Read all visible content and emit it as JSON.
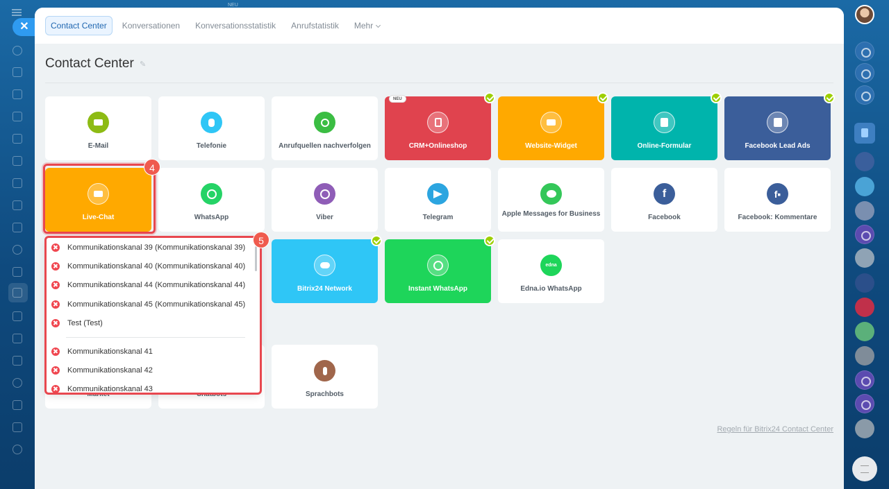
{
  "topbar": {
    "neu_label": "NEU"
  },
  "nav": {
    "tabs": [
      {
        "label": "Contact Center"
      },
      {
        "label": "Konversationen"
      },
      {
        "label": "Konversationsstatistik"
      },
      {
        "label": "Anrufstatistik"
      },
      {
        "label": "Mehr"
      }
    ]
  },
  "page": {
    "title": "Contact Center"
  },
  "cards": {
    "email": "E-Mail",
    "telefonie": "Telefonie",
    "anrufquellen": "Anrufquellen nachverfolgen",
    "crm": "CRM+Onlineshop",
    "crm_badge": "NEU",
    "website": "Website-Widget",
    "online_formular": "Online-Formular",
    "facebook_lead": "Facebook Lead Ads",
    "livechat": "Live-Chat",
    "whatsapp": "WhatsApp",
    "viber": "Viber",
    "telegram": "Telegram",
    "apple": "Apple Messages for Business",
    "facebook": "Facebook",
    "fb_kommentare": "Facebook: Kommentare",
    "bitrix_network": "Bitrix24 Network",
    "instant_whatsapp": "Instant WhatsApp",
    "edna": "Edna.io WhatsApp",
    "edna_logo": "edna",
    "market": "Market",
    "chatbots": "Chatbots",
    "sprachbots": "Sprachbots"
  },
  "annotations": {
    "step4": "4",
    "step5": "5"
  },
  "dropdown": {
    "items": [
      "Kommunikationskanal 39 (Kommunikationskanal 39)",
      "Kommunikationskanal 40 (Kommunikationskanal 40)",
      "Kommunikationskanal 44 (Kommunikationskanal 44)",
      "Kommunikationskanal 45 (Kommunikationskanal 45)",
      "Test (Test)",
      "Kommunikationskanal 41",
      "Kommunikationskanal 42",
      "Kommunikationskanal 43"
    ]
  },
  "footer": {
    "rules_link": "Regeln für Bitrix24 Contact Center"
  },
  "colors": {
    "crm": "#e0434e",
    "orange": "#ffa900",
    "teal": "#00b4ac",
    "fb_blue": "#3b5e9a",
    "bitrix": "#2fc6f6",
    "instant": "#1ed55a",
    "green": "#8dbb14",
    "accent": "#2067b0"
  }
}
